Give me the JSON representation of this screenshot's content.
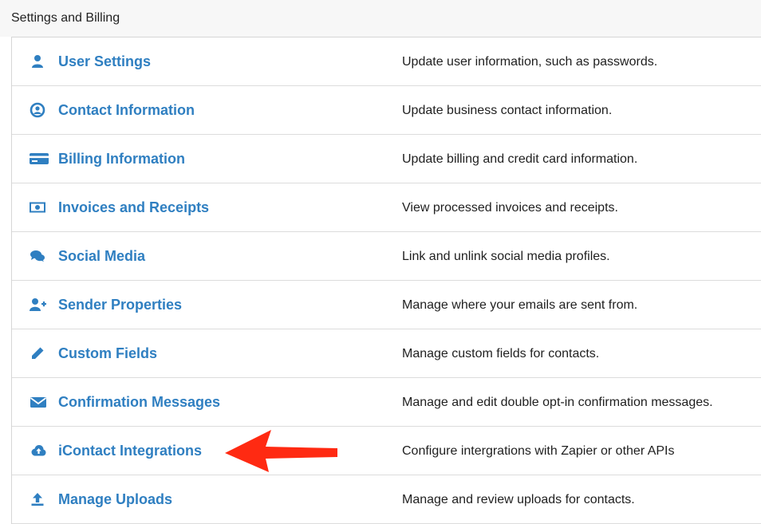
{
  "header": {
    "title": "Settings and Billing"
  },
  "colors": {
    "link": "#2f7fc1",
    "arrow": "#ff2a12"
  },
  "rows": [
    {
      "label": "User Settings",
      "description": "Update user information, such as passwords.",
      "icon": "user-icon"
    },
    {
      "label": "Contact Information",
      "description": "Update business contact information.",
      "icon": "user-circle-icon"
    },
    {
      "label": "Billing Information",
      "description": "Update billing and credit card information.",
      "icon": "credit-card-icon"
    },
    {
      "label": "Invoices and Receipts",
      "description": "View processed invoices and receipts.",
      "icon": "money-bill-icon"
    },
    {
      "label": "Social Media",
      "description": "Link and unlink social media profiles.",
      "icon": "comments-icon"
    },
    {
      "label": "Sender Properties",
      "description": "Manage where your emails are sent from.",
      "icon": "user-plus-icon"
    },
    {
      "label": "Custom Fields",
      "description": "Manage custom fields for contacts.",
      "icon": "pencil-icon"
    },
    {
      "label": "Confirmation Messages",
      "description": "Manage and edit double opt-in confirmation messages.",
      "icon": "envelope-icon"
    },
    {
      "label": "iContact Integrations",
      "description": "Configure intergrations with Zapier or other APIs",
      "icon": "cloud-upload-icon"
    },
    {
      "label": "Manage Uploads",
      "description": "Manage and review uploads for contacts.",
      "icon": "upload-icon"
    }
  ]
}
